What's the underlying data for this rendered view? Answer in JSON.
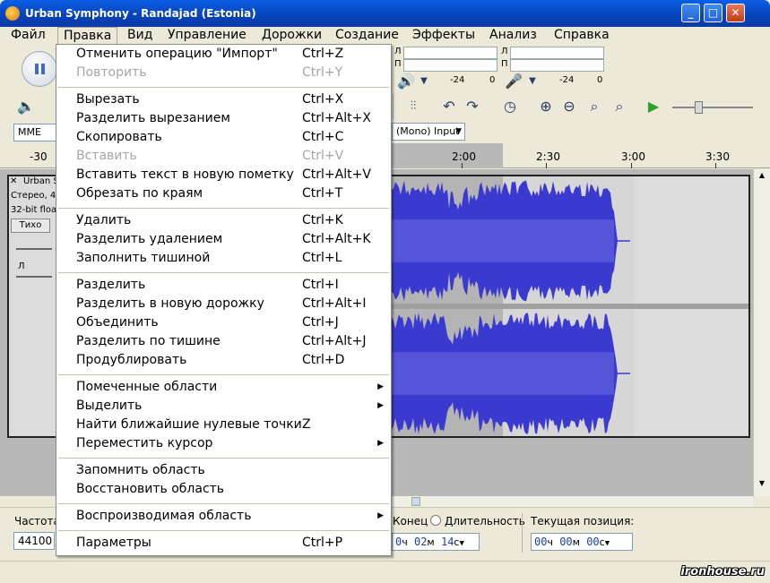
{
  "window": {
    "title": "Urban Symphony - Randajad (Estonia)",
    "min_icon": "minimize-icon",
    "max_icon": "maximize-icon",
    "close_icon": "close-icon"
  },
  "menubar": [
    "Файл",
    "Правка",
    "Вид",
    "Управление",
    "Дорожки",
    "Создание",
    "Эффекты",
    "Анализ",
    "Справка"
  ],
  "edit_menu": {
    "group1": [
      {
        "label": "Отменить операцию \"Импорт\"",
        "shortcut": "Ctrl+Z",
        "enabled": true
      },
      {
        "label": "Повторить",
        "shortcut": "Ctrl+Y",
        "enabled": false
      }
    ],
    "group2": [
      {
        "label": "Вырезать",
        "shortcut": "Ctrl+X",
        "enabled": true
      },
      {
        "label": "Разделить вырезанием",
        "shortcut": "Ctrl+Alt+X",
        "enabled": true
      },
      {
        "label": "Скопировать",
        "shortcut": "Ctrl+C",
        "enabled": true
      },
      {
        "label": "Вставить",
        "shortcut": "Ctrl+V",
        "enabled": false
      },
      {
        "label": "Вставить текст в новую пометку",
        "shortcut": "Ctrl+Alt+V",
        "enabled": true
      },
      {
        "label": "Обрезать по краям",
        "shortcut": "Ctrl+T",
        "enabled": true
      }
    ],
    "group3": [
      {
        "label": "Удалить",
        "shortcut": "Ctrl+K",
        "enabled": true
      },
      {
        "label": "Разделить удалением",
        "shortcut": "Ctrl+Alt+K",
        "enabled": true
      },
      {
        "label": "Заполнить тишиной",
        "shortcut": "Ctrl+L",
        "enabled": true
      }
    ],
    "group4": [
      {
        "label": "Разделить",
        "shortcut": "Ctrl+I",
        "enabled": true
      },
      {
        "label": "Разделить в новую дорожку",
        "shortcut": "Ctrl+Alt+I",
        "enabled": true
      },
      {
        "label": "Объединить",
        "shortcut": "Ctrl+J",
        "enabled": true
      },
      {
        "label": "Разделить по тишине",
        "shortcut": "Ctrl+Alt+J",
        "enabled": true
      },
      {
        "label": "Продублировать",
        "shortcut": "Ctrl+D",
        "enabled": true
      }
    ],
    "group5": [
      {
        "label": "Помеченные области",
        "shortcut": "",
        "submenu": true
      },
      {
        "label": "Выделить",
        "shortcut": "",
        "submenu": true
      },
      {
        "label": "Найти ближайшие нулевые точки",
        "shortcut": "Z",
        "submenu": false
      },
      {
        "label": "Переместить курсор",
        "shortcut": "",
        "submenu": true
      }
    ],
    "group6": [
      {
        "label": "Запомнить область",
        "shortcut": ""
      },
      {
        "label": "Восстановить область",
        "shortcut": ""
      }
    ],
    "group7": [
      {
        "label": "Воспроизводимая область",
        "shortcut": "",
        "submenu": true
      }
    ],
    "group8": [
      {
        "label": "Параметры",
        "shortcut": "Ctrl+P"
      }
    ]
  },
  "toolbar": {
    "meter_l": "Л",
    "meter_p": "П",
    "meter_scale_a": "-24",
    "meter_scale_b": "0",
    "meter_scale_c": "-24",
    "meter_scale_d": "0",
    "host_value": "MME",
    "input_value": "(Mono) Input"
  },
  "ruler": {
    "labels": [
      "-30",
      "2:00",
      "2:30",
      "3:00",
      "3:30"
    ]
  },
  "track": {
    "name": "Urban S",
    "info1": "Стерео, 4",
    "info2": "32-bit float",
    "mute": "Тихо",
    "pan_l": "Л"
  },
  "selectionbar": {
    "rate_label": "Частота",
    "rate_value": "44100",
    "end_label": "Конец",
    "length_label": "Длительность",
    "end_time": {
      "h": "0",
      "hu": "ч",
      "m": "02",
      "mu": "м",
      "s": "14",
      "su": "с"
    },
    "pos_label": "Текущая позиция:",
    "pos_time": {
      "h": "00",
      "hu": "ч",
      "m": "00",
      "mu": "м",
      "s": "00",
      "su": "с"
    }
  },
  "watermark": "ironhouse.ru",
  "colors": {
    "wave": "#3a3ad0",
    "wave_light": "#6c6ce0",
    "selection": "#b8b8b8"
  }
}
